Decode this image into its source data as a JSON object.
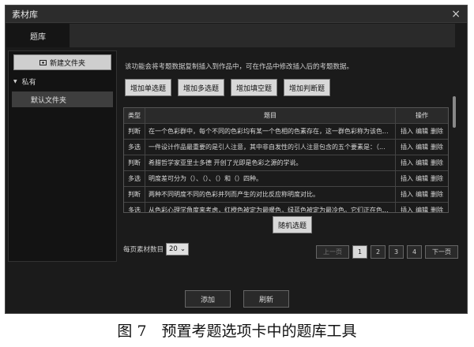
{
  "window": {
    "title": "素材库",
    "close_glyph": "×"
  },
  "tabs": [
    {
      "label": "题库",
      "active": true
    }
  ],
  "sidebar": {
    "new_folder_label": "新建文件夹",
    "new_folder_icon": "folder-plus-icon",
    "root_label": "私有",
    "root_icon": "caret-down-icon",
    "items": [
      {
        "label": "默认文件夹",
        "selected": true
      }
    ]
  },
  "main": {
    "info_text": "该功能会将考题数据复制插入到作品中，可在作品中修改插入后的考题数据。",
    "add_buttons": [
      "增加单选题",
      "增加多选题",
      "增加填空题",
      "增加判断题"
    ],
    "table": {
      "headers": {
        "type": "类型",
        "question": "题目",
        "action": "操作"
      },
      "actions": {
        "insert": "插入",
        "edit": "编辑",
        "delete": "删除"
      },
      "rows": [
        {
          "type": "判断",
          "question": "在一个色彩群中，每个不同的色彩均有某一个色相的色素存在，这一群色彩称为该色..."
        },
        {
          "type": "多选",
          "question": "一件设计作品最重要的是引人注意，其中非自发性的引人注意包含的五个要素是：（..."
        },
        {
          "type": "判断",
          "question": "希腊哲学家亚里士多德 开创了光即是色彩之源的学说。"
        },
        {
          "type": "多选",
          "question": "明度差可分为（）、（）、（）和（）四种。"
        },
        {
          "type": "判断",
          "question": "两种不同明度不同的色彩并列而产生的对比反应称明度对比。"
        },
        {
          "type": "多选",
          "question": "从色彩心理学角度来考虑，红橙色被定为最暖色，绿蓝色被定为最冷色。它们正在色..."
        }
      ]
    },
    "random_button": "随机选题",
    "per_page_label": "每页素材数目",
    "per_page_value": "20",
    "per_page_icon": "chevron-down-icon",
    "pager": {
      "prev": "上一页",
      "pages": [
        "1",
        "2",
        "3",
        "4"
      ],
      "current": "1",
      "next": "下一页"
    }
  },
  "footer": {
    "add_label": "添加",
    "refresh_label": "刷新"
  },
  "caption": "图 7　预置考题选项卡中的题库工具"
}
